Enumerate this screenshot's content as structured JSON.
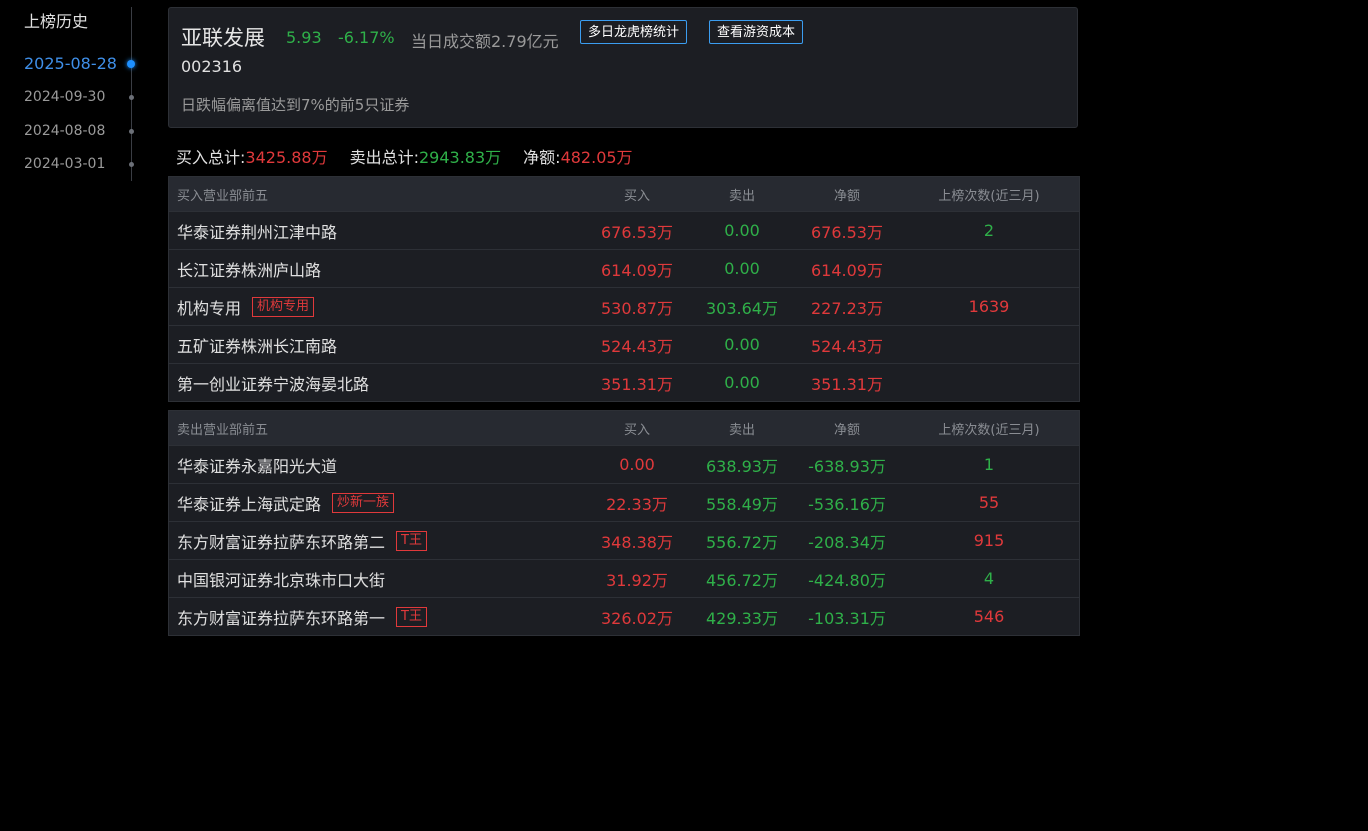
{
  "history": {
    "title": "上榜历史",
    "dates": [
      "2025-08-28",
      "2024-09-30",
      "2024-08-08",
      "2024-03-01"
    ],
    "active_index": 0
  },
  "stock": {
    "name": "亚联发展",
    "price": "5.93",
    "change": "-6.17%",
    "turnover": "当日成交额2.79亿元",
    "code": "002316",
    "reason": "日跌幅偏离值达到7%的前5只证券",
    "btn_multi_day": "多日龙虎榜统计",
    "btn_cost": "查看游资成本"
  },
  "totals": {
    "buy_label": "买入总计:",
    "buy_value": "3425.88万",
    "sell_label": "卖出总计:",
    "sell_value": "2943.83万",
    "net_label": "净额:",
    "net_value": "482.05万"
  },
  "buy_table": {
    "headers": [
      "买入营业部前五",
      "买入",
      "卖出",
      "净额",
      "上榜次数(近三月)"
    ],
    "rows": [
      {
        "name": "华泰证券荆州江津中路",
        "tag": "",
        "buy": "676.53万",
        "sell": "0.00",
        "net": "676.53万",
        "count": "2"
      },
      {
        "name": "长江证券株洲庐山路",
        "tag": "",
        "buy": "614.09万",
        "sell": "0.00",
        "net": "614.09万",
        "count": ""
      },
      {
        "name": "机构专用",
        "tag": "机构专用",
        "buy": "530.87万",
        "sell": "303.64万",
        "net": "227.23万",
        "count": "1639"
      },
      {
        "name": "五矿证券株洲长江南路",
        "tag": "",
        "buy": "524.43万",
        "sell": "0.00",
        "net": "524.43万",
        "count": ""
      },
      {
        "name": "第一创业证券宁波海晏北路",
        "tag": "",
        "buy": "351.31万",
        "sell": "0.00",
        "net": "351.31万",
        "count": ""
      }
    ]
  },
  "sell_table": {
    "headers": [
      "卖出营业部前五",
      "买入",
      "卖出",
      "净额",
      "上榜次数(近三月)"
    ],
    "rows": [
      {
        "name": "华泰证券永嘉阳光大道",
        "tag": "",
        "buy": "0.00",
        "sell": "638.93万",
        "net": "-638.93万",
        "count": "1"
      },
      {
        "name": "华泰证券上海武定路",
        "tag": "炒新一族",
        "buy": "22.33万",
        "sell": "558.49万",
        "net": "-536.16万",
        "count": "55"
      },
      {
        "name": "东方财富证券拉萨东环路第二",
        "tag": "T王",
        "buy": "348.38万",
        "sell": "556.72万",
        "net": "-208.34万",
        "count": "915"
      },
      {
        "name": "中国银河证券北京珠市口大街",
        "tag": "",
        "buy": "31.92万",
        "sell": "456.72万",
        "net": "-424.80万",
        "count": "4"
      },
      {
        "name": "东方财富证券拉萨东环路第一",
        "tag": "T王",
        "buy": "326.02万",
        "sell": "429.33万",
        "net": "-103.31万",
        "count": "546"
      }
    ]
  },
  "colors": {
    "up": "#e0393b",
    "down": "#2fb049",
    "accent": "#1e90ff"
  }
}
